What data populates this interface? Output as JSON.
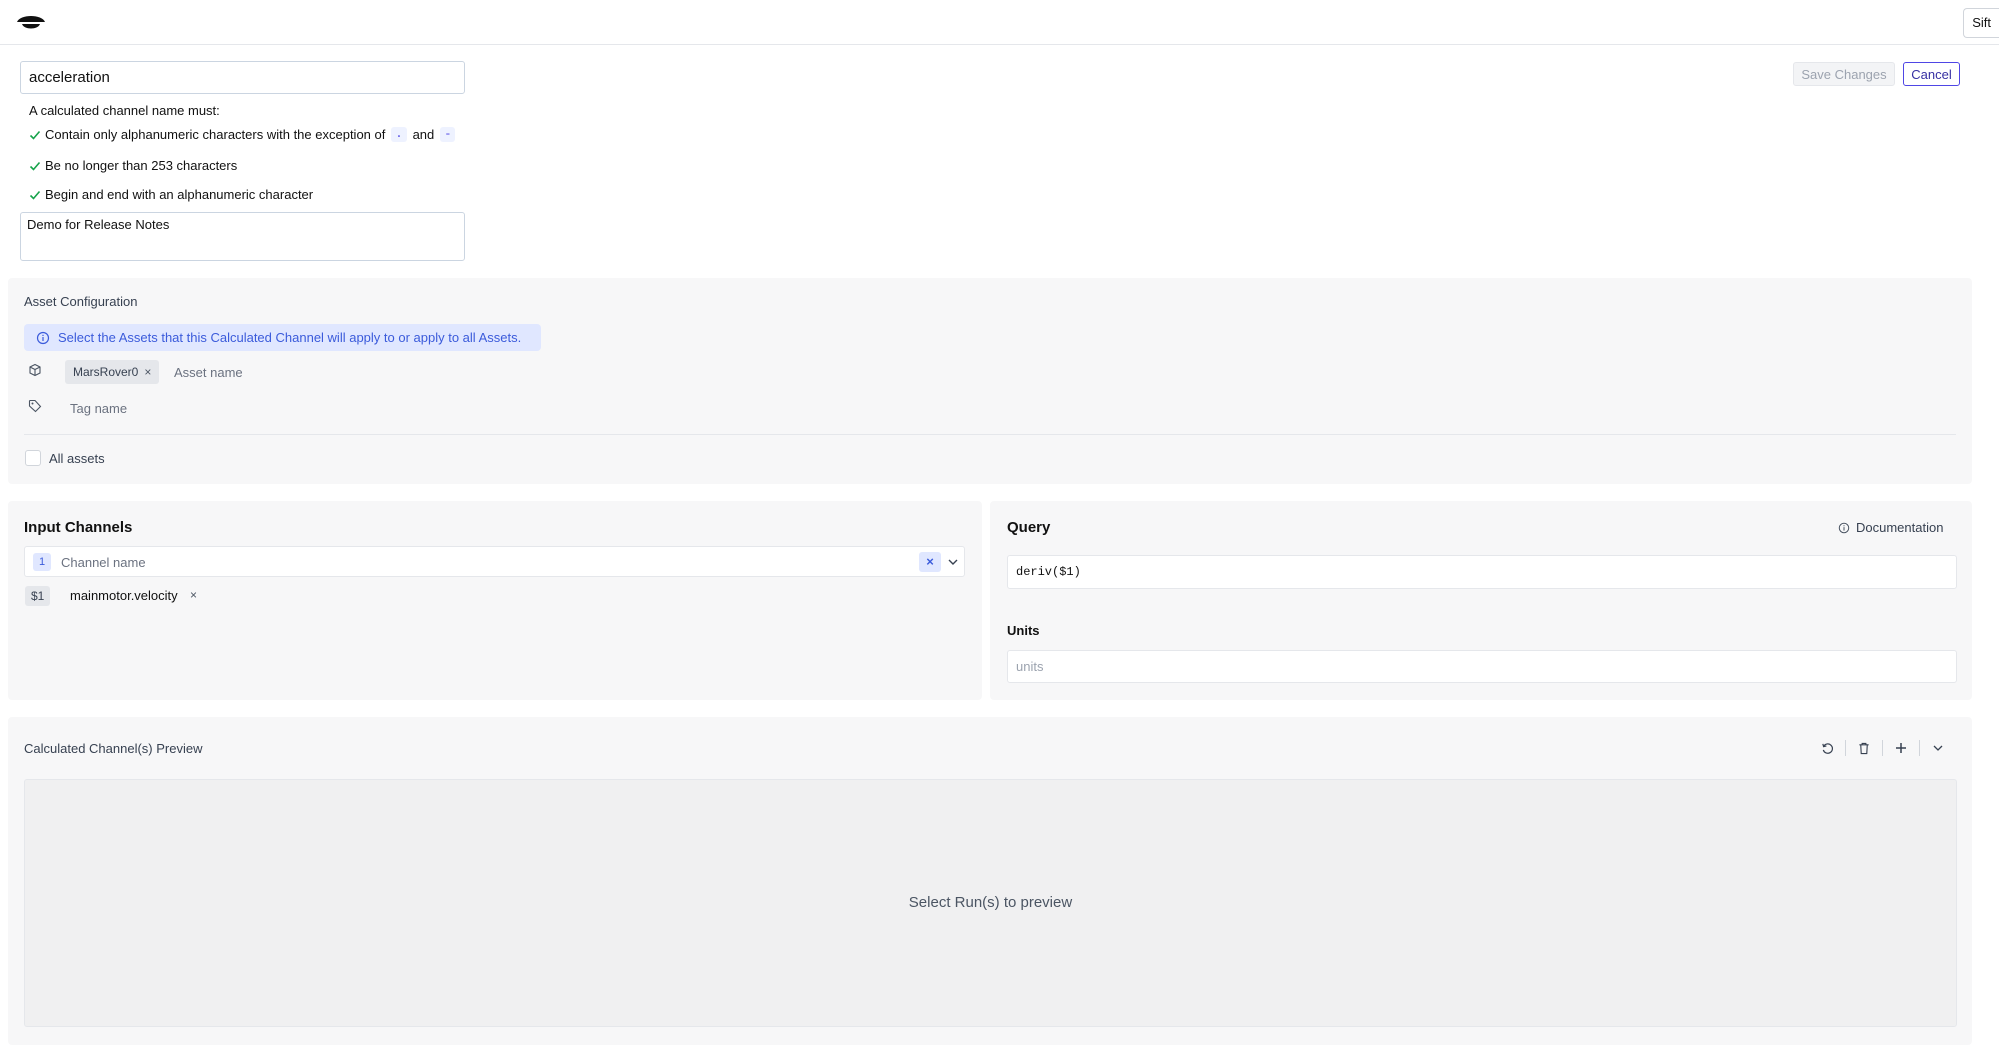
{
  "app": {
    "user_button": "Sift"
  },
  "form": {
    "name_value": "acceleration",
    "rules_title": "A calculated channel name must:",
    "rule_1_prefix": "Contain only alphanumeric characters with the exception of",
    "rule_1_char_a": ".",
    "rule_1_and": "and",
    "rule_1_char_b": "-",
    "rule_2": "Be no longer than 253 characters",
    "rule_3": "Begin and end with an alphanumeric character",
    "description_value": "Demo for Release Notes",
    "save_label": "Save Changes",
    "cancel_label": "Cancel"
  },
  "asset_config": {
    "title": "Asset Configuration",
    "info": "Select the Assets that this Calculated Channel will apply to or apply to all Assets.",
    "asset_chip": "MarsRover0",
    "asset_placeholder": "Asset name",
    "tag_placeholder": "Tag name",
    "all_assets_label": "All assets"
  },
  "input_channels": {
    "title": "Input Channels",
    "index": "1",
    "placeholder": "Channel name",
    "variable": "$1",
    "channel": "mainmotor.velocity"
  },
  "query": {
    "title": "Query",
    "doc_label": "Documentation",
    "value": "deriv($1)",
    "units_label": "Units",
    "units_placeholder": "units"
  },
  "preview": {
    "title": "Calculated Channel(s) Preview",
    "message": "Select Run(s) to preview"
  },
  "colors": {
    "accent": "#4f46e5",
    "info_bg": "#e0e7ff",
    "check": "#16a34a"
  }
}
